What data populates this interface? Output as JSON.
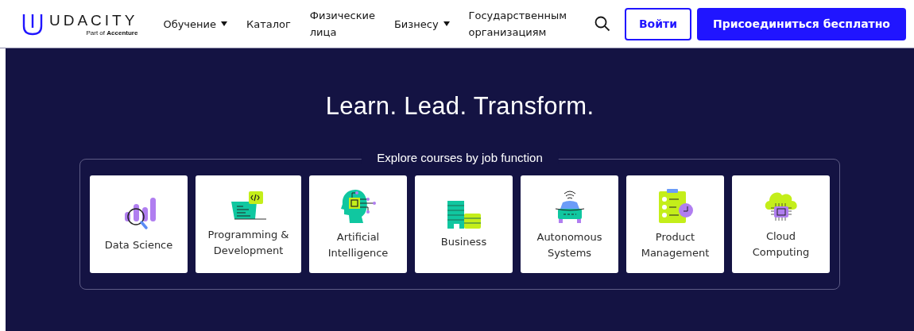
{
  "header": {
    "logo": {
      "wordmark": "UDACITY",
      "tagline_prefix": "Part of",
      "tagline_brand": "Accenture"
    },
    "nav": [
      {
        "label": "Обучение",
        "dropdown": true
      },
      {
        "label": "Каталог",
        "dropdown": false
      },
      {
        "label": "Физические лица",
        "dropdown": false
      },
      {
        "label": "Бизнесу",
        "dropdown": true
      },
      {
        "label": "Государственным организациям",
        "dropdown": false
      }
    ],
    "login": "Войти",
    "signup": "Присоединиться бесплатно"
  },
  "hero": {
    "title": "Learn. Lead. Transform.",
    "section_title": "Explore courses by job function",
    "categories": [
      {
        "label": "Data Science"
      },
      {
        "label": "Programming & Development"
      },
      {
        "label": "Artificial Intelligence"
      },
      {
        "label": "Business"
      },
      {
        "label": "Autonomous Systems"
      },
      {
        "label": "Product Management"
      },
      {
        "label": "Cloud Computing"
      }
    ]
  }
}
